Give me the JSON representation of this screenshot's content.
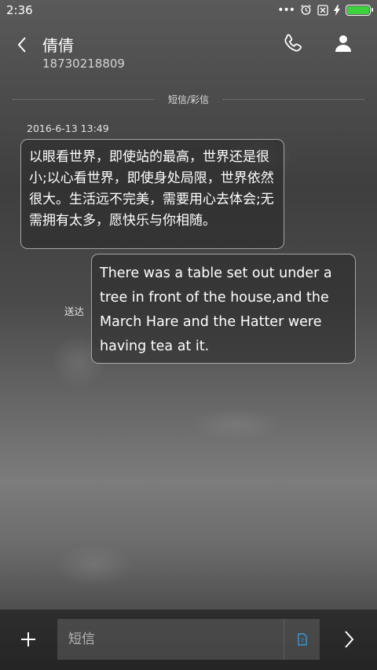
{
  "status_bar": {
    "time": "2:36",
    "battery_color": "#3ed33e",
    "battery_level": 1.0,
    "icons": [
      "more-dots-icon",
      "alarm-icon",
      "no-sim-icon",
      "charging-bolt-icon",
      "battery-icon"
    ]
  },
  "header": {
    "contact_name": "倩倩",
    "phone_number": "18730218809",
    "icons": [
      "back-arrow-icon",
      "phone-icon",
      "person-icon"
    ]
  },
  "thread": {
    "channel_label": "短信/彩信",
    "timestamp": "2016-6-13 13:49",
    "messages": [
      {
        "direction": "incoming",
        "text": "以眼看世界，即使站的最高，世界还是很小;以心看世界，即使身处局限，世界依然很大。生活远不完美，需要用心去体会;无需拥有太多，愿快乐与你相随。"
      },
      {
        "direction": "outgoing",
        "status": "送达",
        "text": "There was a table set out under a tree in front of the house,and the March Hare and the Hatter were having tea at it."
      }
    ]
  },
  "composer": {
    "placeholder": "短信",
    "accent_color": "#3a9ad9",
    "icons": [
      "plus-icon",
      "template-icon",
      "send-chevron-icon"
    ]
  }
}
